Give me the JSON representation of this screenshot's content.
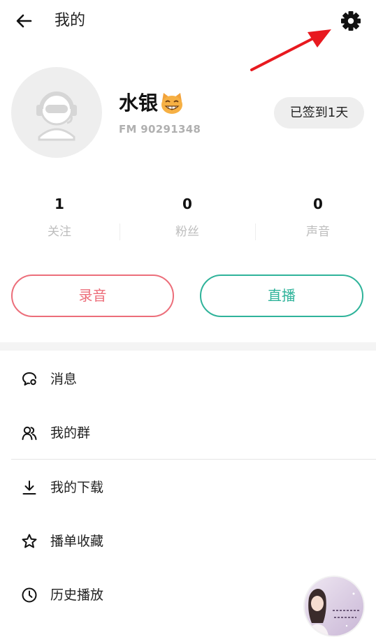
{
  "header": {
    "title": "我的"
  },
  "profile": {
    "name": "水银",
    "name_emoji": "😸",
    "id_text": "FM 90291348",
    "checkin_label": "已签到1天"
  },
  "stats": [
    {
      "value": "1",
      "label": "关注"
    },
    {
      "value": "0",
      "label": "粉丝"
    },
    {
      "value": "0",
      "label": "声音"
    }
  ],
  "actions": {
    "record_label": "录音",
    "live_label": "直播"
  },
  "menu": [
    {
      "label": "消息",
      "icon": "message-icon"
    },
    {
      "label": "我的群",
      "icon": "group-icon"
    },
    {
      "label": "我的下载",
      "icon": "download-icon"
    },
    {
      "label": "播单收藏",
      "icon": "star-icon"
    },
    {
      "label": "历史播放",
      "icon": "clock-icon"
    }
  ],
  "colors": {
    "record": "#ec6e7a",
    "live": "#2fb39a",
    "annotation_arrow": "#e8191f"
  }
}
